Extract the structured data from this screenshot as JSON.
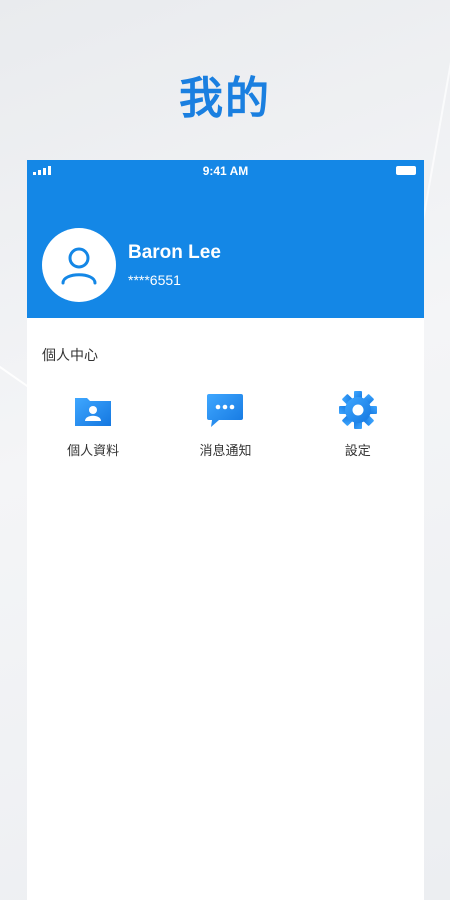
{
  "page": {
    "title": "我的"
  },
  "status_bar": {
    "time": "9:41 AM"
  },
  "profile": {
    "name": "Baron Lee",
    "phone_masked": "****6551"
  },
  "personal_center": {
    "title": "個人中心",
    "items": [
      {
        "label": "個人資料",
        "icon": "profile-folder-icon"
      },
      {
        "label": "消息通知",
        "icon": "message-bubble-icon"
      },
      {
        "label": "設定",
        "icon": "gear-icon"
      }
    ]
  },
  "colors": {
    "accent": "#1487e6",
    "title": "#1a7fe0"
  }
}
